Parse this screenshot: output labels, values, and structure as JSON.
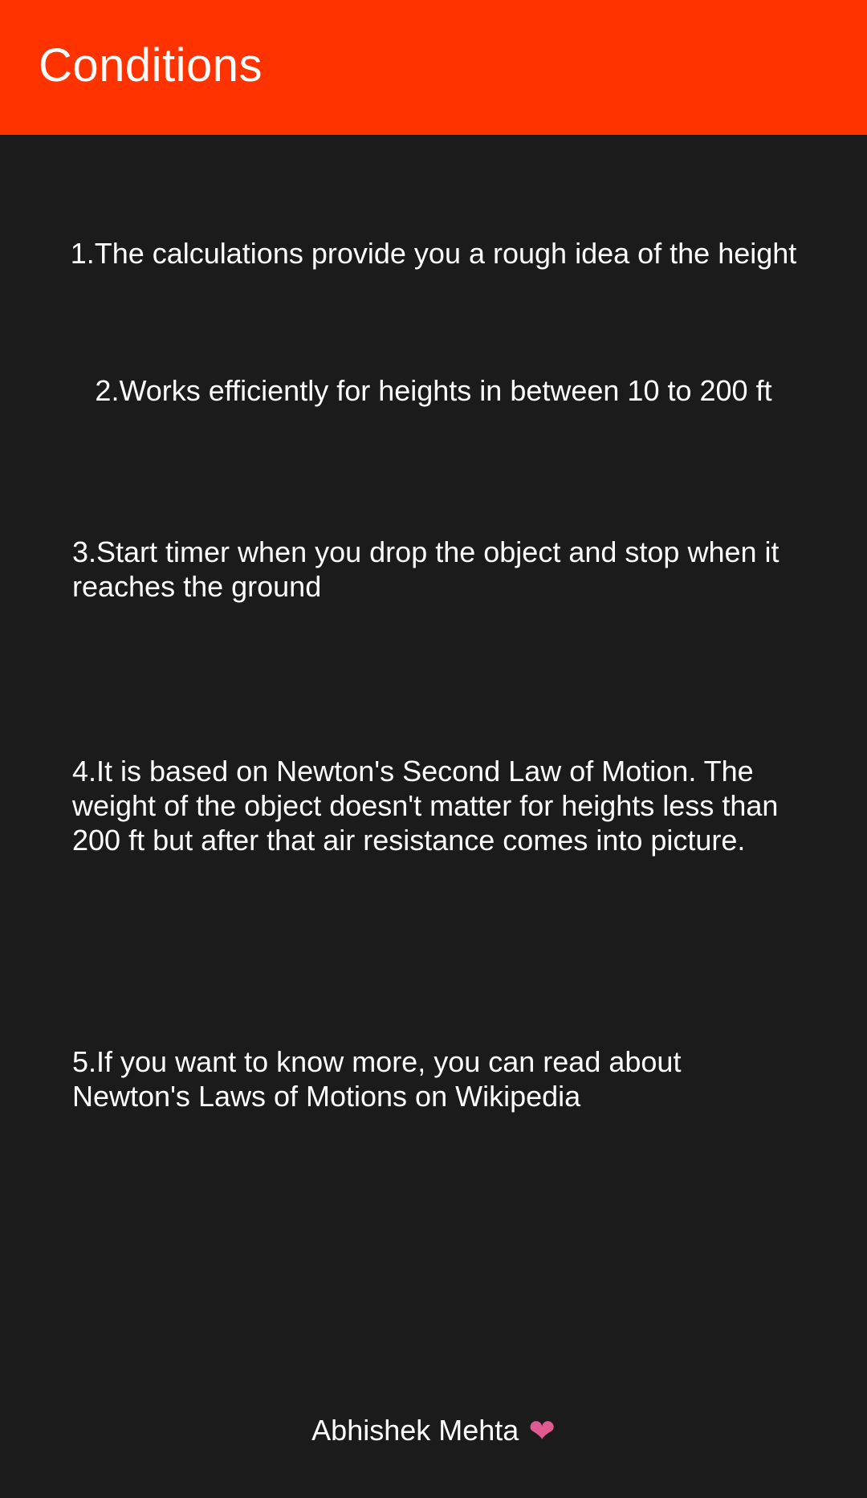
{
  "app_bar": {
    "title": "Conditions",
    "color": "#ff3300"
  },
  "conditions": [
    "1.The calculations provide you a rough idea of the height",
    "2.Works efficiently for heights in between 10 to 200 ft",
    "3.Start timer when you drop the object and stop when it reaches the ground",
    "4.It is based on Newton's Second Law of Motion. The weight of the object doesn't matter for heights less than 200 ft but after that air resistance comes into picture.",
    "5.If you want to know more, you can read about Newton's Laws of Motions on Wikipedia"
  ],
  "footer": {
    "author": "Abhishek Mehta",
    "icon": "heart-icon",
    "icon_color": "#e05a92"
  },
  "colors": {
    "background": "#1b1b1b",
    "text": "#ffffff"
  }
}
